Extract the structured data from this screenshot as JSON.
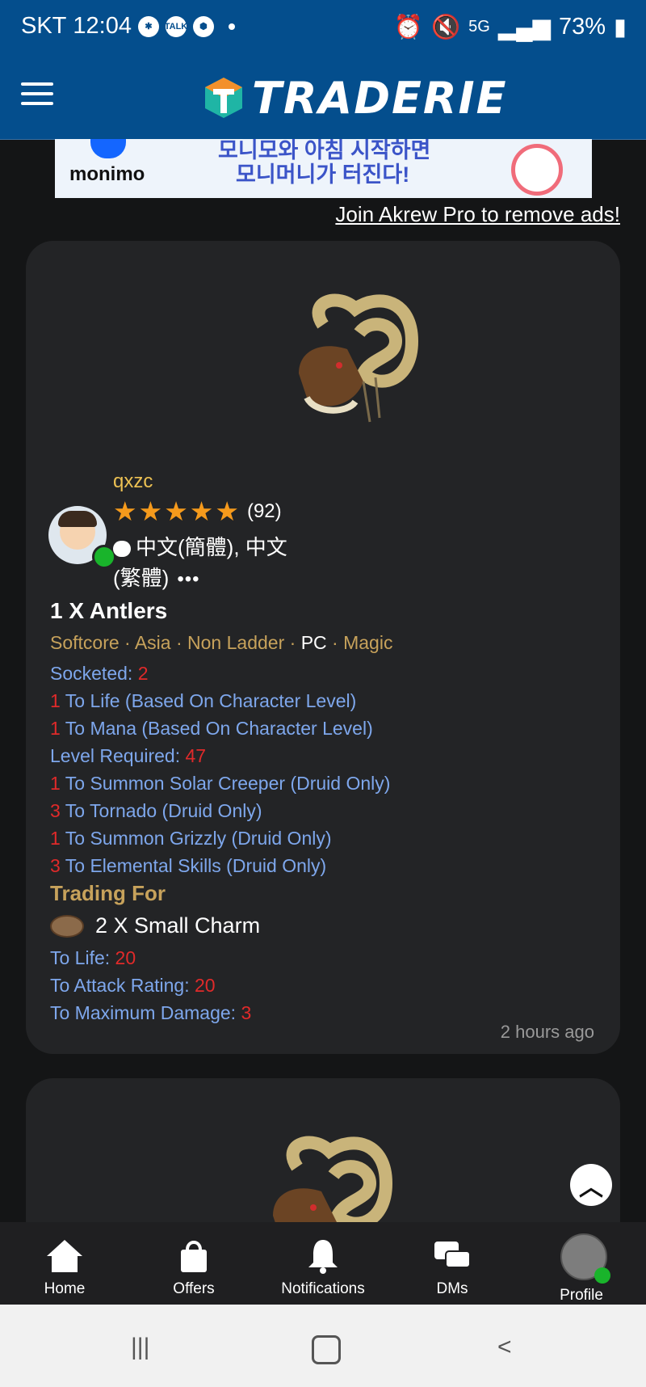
{
  "status": {
    "carrier": "SKT",
    "time": "12:04",
    "app_icons": [
      "settings-wheel-icon",
      "talk-icon",
      "shield-icon"
    ],
    "network": "5G",
    "battery": "73%"
  },
  "appbar": {
    "logo_text": "TRADERIE"
  },
  "ad": {
    "brand": "monimo",
    "line1": "모니모와 아침 시작하면",
    "line2": "모니머니가 터진다!"
  },
  "ad_removal_link": "Join Akrew Pro to remove ads!",
  "listing": {
    "seller": {
      "name": "qxzc",
      "rating_count": "(92)",
      "languages": "中文(簡體), 中文(繁體)",
      "more": "•••"
    },
    "title": "1 X Antlers",
    "meta": [
      {
        "text": "Softcore",
        "highlight": false
      },
      {
        "text": " · ",
        "highlight": false
      },
      {
        "text": "Asia",
        "highlight": false
      },
      {
        "text": " · ",
        "highlight": false
      },
      {
        "text": "Non Ladder",
        "highlight": false
      },
      {
        "text": " · ",
        "highlight": false
      },
      {
        "text": "PC",
        "highlight": true
      },
      {
        "text": " · ",
        "highlight": false
      },
      {
        "text": "Magic",
        "highlight": false
      }
    ],
    "properties": [
      {
        "pre": "",
        "label": "Socketed: ",
        "num": "2"
      },
      {
        "pre": "1",
        "label": " To Life (Based On Character Level)",
        "num": ""
      },
      {
        "pre": "1",
        "label": " To Mana (Based On Character Level)",
        "num": ""
      },
      {
        "pre": "",
        "label": "Level Required: ",
        "num": "47"
      },
      {
        "pre": "1",
        "label": " To Summon Solar Creeper (Druid Only)",
        "num": ""
      },
      {
        "pre": "3",
        "label": " To Tornado (Druid Only)",
        "num": ""
      },
      {
        "pre": "1",
        "label": " To Summon Grizzly (Druid Only)",
        "num": ""
      },
      {
        "pre": "3",
        "label": " To Elemental Skills (Druid Only)",
        "num": ""
      }
    ],
    "trading_for_label": "Trading For",
    "wanted_item": "2 X Small Charm",
    "wanted_properties": [
      {
        "label": "To Life: ",
        "num": "20"
      },
      {
        "label": "To Attack Rating: ",
        "num": "20"
      },
      {
        "label": "To Maximum Damage: ",
        "num": "3"
      }
    ],
    "posted": "2 hours ago"
  },
  "tabs": [
    {
      "label": "Home",
      "icon": "home-icon"
    },
    {
      "label": "Offers",
      "icon": "bag-icon"
    },
    {
      "label": "Notifications",
      "icon": "bell-icon"
    },
    {
      "label": "DMs",
      "icon": "chat-icon"
    },
    {
      "label": "Profile",
      "icon": "avatar"
    }
  ],
  "colors": {
    "brand_blue": "#044e8d",
    "gold": "#c7a25b",
    "stat_blue": "#7ea7ec",
    "stat_red": "#e02a2a",
    "online_green": "#19b42b",
    "star_orange": "#f59a1c"
  }
}
